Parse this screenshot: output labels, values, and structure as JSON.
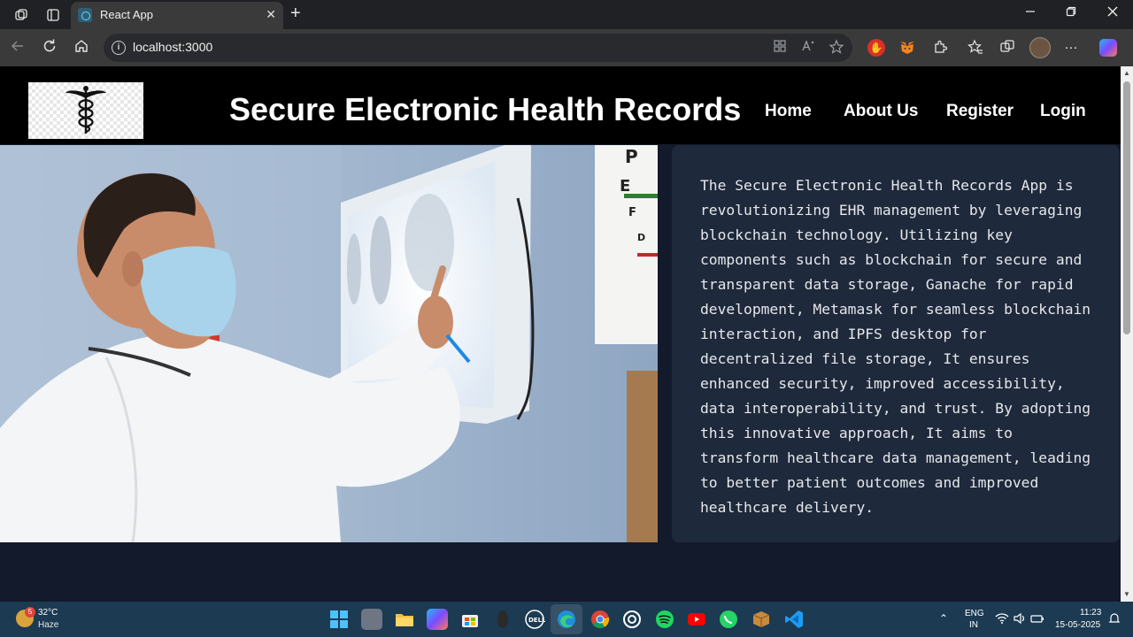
{
  "browser": {
    "tab_title": "React App",
    "tab_close": "✕",
    "new_tab": "+",
    "url": "localhost:3000",
    "icons": [
      "workspaces-icon",
      "tab-actions-icon",
      "back-icon",
      "refresh-icon",
      "home-icon",
      "info-icon",
      "app-available-icon",
      "read-aloud-icon",
      "favorite-icon",
      "extension-icon",
      "favorites-icon",
      "collections-icon",
      "profile-icon",
      "more-icon",
      "copilot-icon"
    ]
  },
  "header": {
    "title": "Secure Electronic Health Records",
    "nav": {
      "home": "Home",
      "about": "About Us",
      "register": "Register",
      "login": "Login"
    }
  },
  "about": {
    "text": "The Secure Electronic Health Records App is revolutionizing EHR management by leveraging blockchain technology. Utilizing key components such as blockchain for secure and transparent data storage, Ganache for rapid development, Metamask for seamless blockchain interaction, and IPFS desktop for decentralized file storage, It ensures enhanced security, improved accessibility, data interoperability, and trust. By adopting this innovative approach, It aims to transform healthcare data management, leading to better patient outcomes and improved healthcare delivery."
  },
  "taskbar": {
    "weather_badge": "5",
    "temp": "32°C",
    "condition": "Haze",
    "lang_top": "ENG",
    "lang_bottom": "IN",
    "time": "11:23",
    "date": "15-05-2025"
  },
  "colors": {
    "header_bg": "#000000",
    "page_bg": "#131a2b",
    "card_bg": "#1e293b",
    "taskbar_bg": "#1c3a52"
  }
}
